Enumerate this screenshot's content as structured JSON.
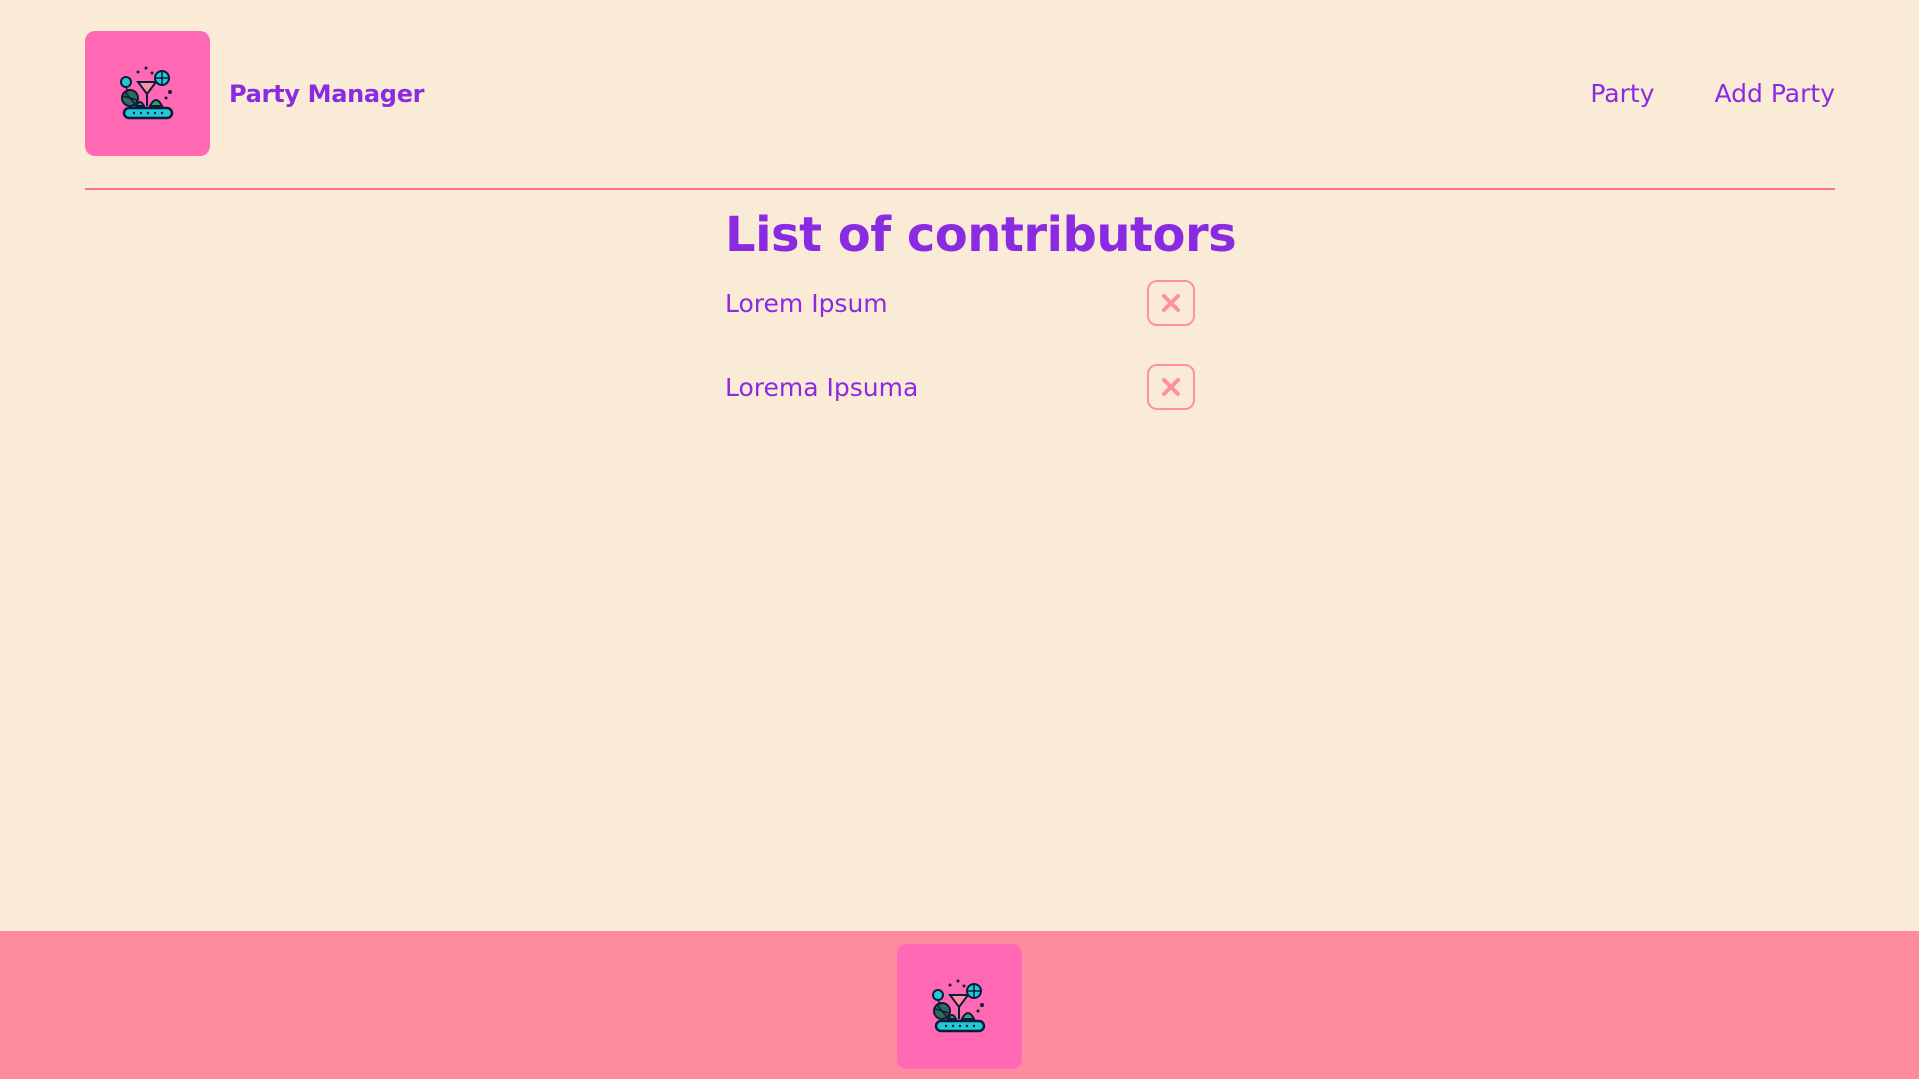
{
  "header": {
    "brand_name": "Party Manager",
    "logo_icon": "party-logo-icon",
    "nav": [
      {
        "label": "Party"
      },
      {
        "label": "Add Party"
      }
    ]
  },
  "main": {
    "title": "List of contributors",
    "contributors": [
      {
        "name": "Lorem Ipsum",
        "remove_icon": "close-icon"
      },
      {
        "name": "Lorema Ipsuma",
        "remove_icon": "close-icon"
      }
    ]
  },
  "footer": {
    "logo_icon": "party-logo-icon"
  },
  "colors": {
    "background": "#FAEBD7",
    "accent": "#8A2BE2",
    "logo_tile": "#FF69B4",
    "footer": "#FF8C9E",
    "divider": "#FF6F91",
    "remove_button_border": "#FF8FA3"
  }
}
